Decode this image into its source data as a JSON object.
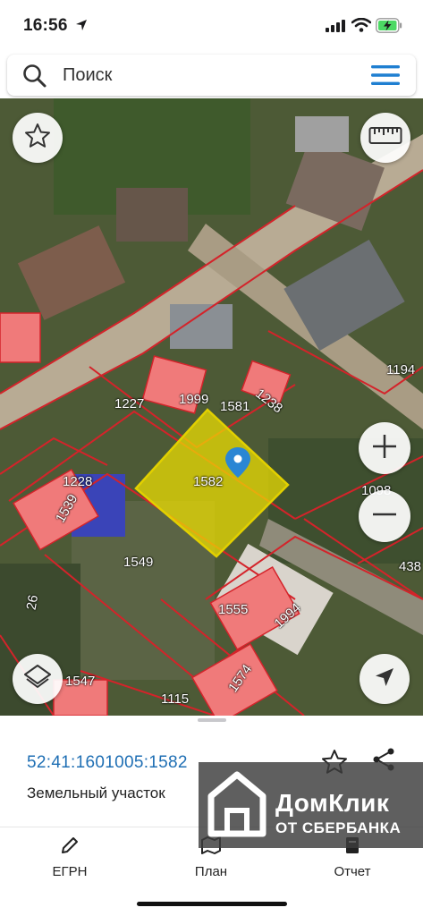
{
  "status_bar": {
    "time": "16:56",
    "battery_charging": true
  },
  "search": {
    "placeholder": "Поиск",
    "icon": "search-icon",
    "menu_icon": "hamburger-menu-icon"
  },
  "map": {
    "parcel_labels": [
      "1999",
      "1581",
      "1238",
      "1227",
      "1582",
      "1228",
      "1539",
      "1549",
      "1555",
      "1994",
      "1547",
      "1115",
      "1574",
      "26",
      "1194",
      "1098",
      "438"
    ],
    "selected_parcel": "1582",
    "highlight_color": "#f0e000",
    "boundary_color": "#d4232a",
    "building_color": "#f07a7a",
    "controls": {
      "favorite": "star-icon",
      "measure": "ruler-icon",
      "zoom_in": "plus-icon",
      "zoom_out": "minus-icon",
      "layers": "layers-icon",
      "locate": "navigation-arrow-icon"
    }
  },
  "info": {
    "cadastral_number": "52:41:1601005:1582",
    "type": "Земельный участок",
    "accent_color": "#1f6fb4"
  },
  "watermark": {
    "title": "ДомКлик",
    "subtitle": "ОТ СБЕРБАНКА"
  },
  "tabs": [
    {
      "label": "ЕГРН",
      "icon": "pencil-icon"
    },
    {
      "label": "План",
      "icon": "map-icon"
    },
    {
      "label": "Отчет",
      "icon": "report-icon"
    }
  ]
}
